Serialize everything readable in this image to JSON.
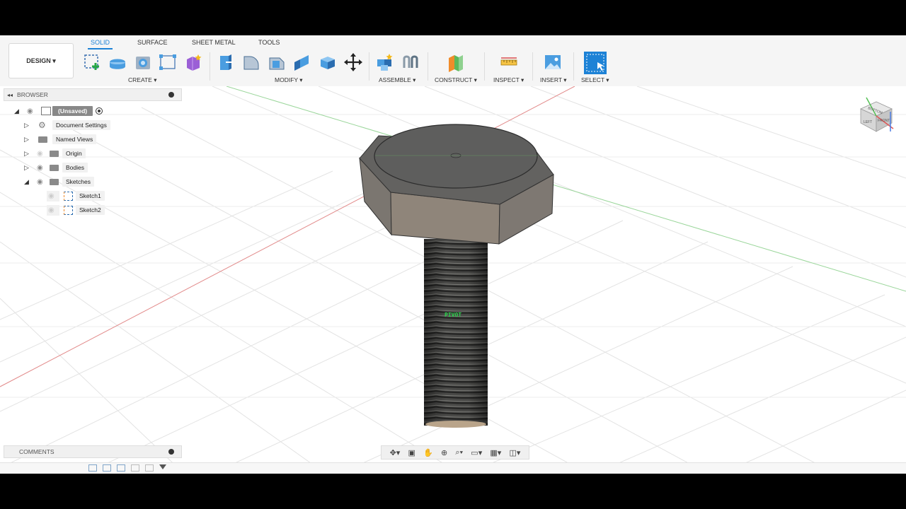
{
  "workspace": {
    "label": "DESIGN",
    "caret": "▾"
  },
  "tabs": [
    "SOLID",
    "SURFACE",
    "SHEET METAL",
    "TOOLS"
  ],
  "active_tab": "SOLID",
  "groups": {
    "create": "CREATE ▾",
    "modify": "MODIFY ▾",
    "assemble": "ASSEMBLE ▾",
    "construct": "CONSTRUCT ▾",
    "inspect": "INSPECT ▾",
    "insert": "INSERT ▾",
    "select": "SELECT ▾"
  },
  "browser": {
    "title": "BROWSER",
    "items": [
      {
        "label": "(Unsaved)"
      },
      {
        "label": "Document Settings"
      },
      {
        "label": "Named Views"
      },
      {
        "label": "Origin"
      },
      {
        "label": "Bodies"
      },
      {
        "label": "Sketches"
      },
      {
        "label": "Sketch1"
      },
      {
        "label": "Sketch2"
      }
    ]
  },
  "comments": {
    "title": "COMMENTS"
  },
  "viewport": {
    "pivot_label": "PIVOT"
  },
  "viewcube": {
    "faces": [
      "BOTTOM",
      "LEFT",
      "FRONT"
    ]
  },
  "colors": {
    "accent": "#1d82d6",
    "x_axis": "#e05555",
    "y_axis": "#55c055",
    "z_axis": "#4a7be0"
  }
}
